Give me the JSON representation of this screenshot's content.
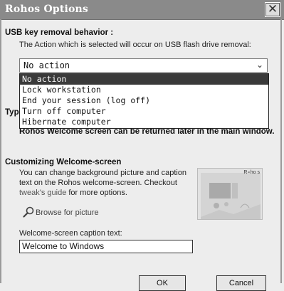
{
  "window": {
    "title": "Rohos Options",
    "close_glyph": "✕"
  },
  "usb": {
    "heading": "USB key removal behavior :",
    "description": "The Action which is selected will occur on USB flash drive removal:",
    "selected": "No action",
    "options": [
      "No action",
      "Lock workstation",
      "End your session (log off)",
      "Turn off computer",
      "Hibernate computer"
    ]
  },
  "welcome": {
    "type_label_partial": "Typ",
    "return_note": "Rohos Welcome screen can be returned later in the main window."
  },
  "customize": {
    "heading": "Customizing Welcome-screen",
    "line1": "You can change background picture and caption",
    "line2": "text on the Rohos welcome-screen. Checkout",
    "link": "tweak's guide",
    "line3_rest": " for more options.",
    "browse_label": "Browse for picture",
    "preview_badge": "R∘ho s",
    "caption_label": "Welcome-screen caption text:",
    "caption_value": "Welcome to Windows"
  },
  "buttons": {
    "ok": "OK",
    "cancel": "Cancel"
  }
}
